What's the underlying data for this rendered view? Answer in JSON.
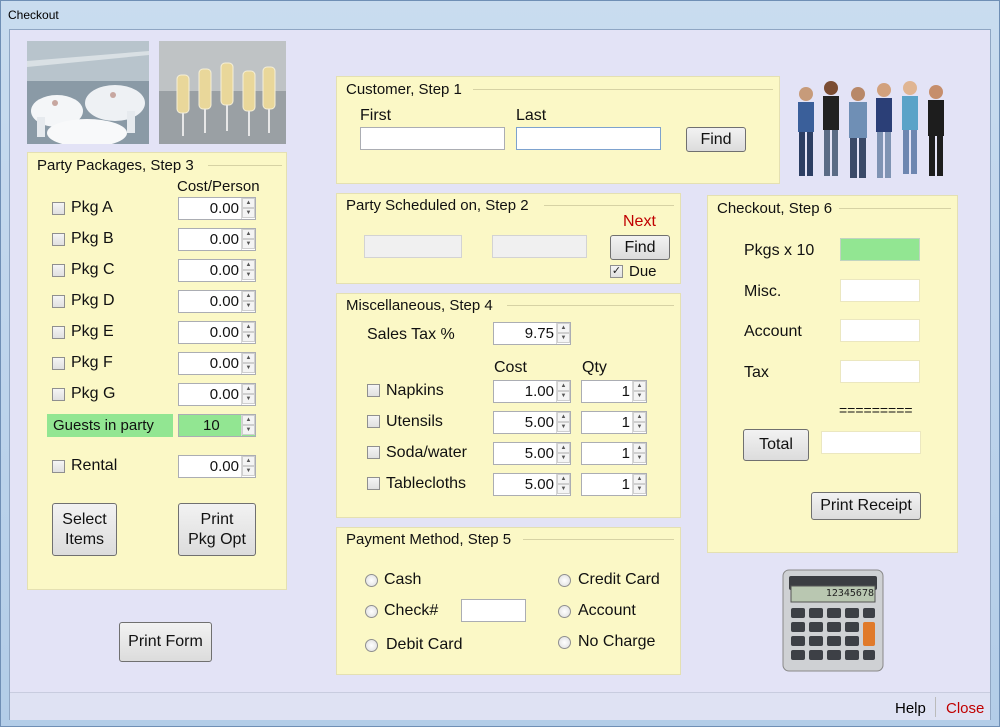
{
  "window": {
    "title": "Checkout"
  },
  "packages": {
    "title": "Party Packages, Step 3",
    "cost_header": "Cost/Person",
    "items": [
      {
        "label": "Pkg A",
        "value": "0.00"
      },
      {
        "label": "Pkg B",
        "value": "0.00"
      },
      {
        "label": "Pkg C",
        "value": "0.00"
      },
      {
        "label": "Pkg D",
        "value": "0.00"
      },
      {
        "label": "Pkg E",
        "value": "0.00"
      },
      {
        "label": "Pkg F",
        "value": "0.00"
      },
      {
        "label": "Pkg G",
        "value": "0.00"
      }
    ],
    "guests_label": "Guests in party",
    "guests_value": "10",
    "rental_label": "Rental",
    "rental_value": "0.00",
    "select_items_line1": "Select",
    "select_items_line2": "Items",
    "print_pkg_line1": "Print",
    "print_pkg_line2": "Pkg Opt"
  },
  "print_form_label": "Print Form",
  "customer": {
    "title": "Customer, Step 1",
    "first_label": "First",
    "last_label": "Last",
    "first_value": "",
    "last_value": "",
    "find_label": "Find"
  },
  "schedule": {
    "title": "Party Scheduled on, Step 2",
    "next_label": "Next",
    "find_label": "Find",
    "due_label": "Due",
    "due_checked": true
  },
  "misc": {
    "title": "Miscellaneous, Step 4",
    "sales_tax_label": "Sales Tax %",
    "sales_tax_value": "9.75",
    "cost_header": "Cost",
    "qty_header": "Qty",
    "items": [
      {
        "label": "Napkins",
        "cost": "1.00",
        "qty": "1"
      },
      {
        "label": "Utensils",
        "cost": "5.00",
        "qty": "1"
      },
      {
        "label": "Soda/water",
        "cost": "5.00",
        "qty": "1"
      },
      {
        "label": "Tablecloths",
        "cost": "5.00",
        "qty": "1"
      }
    ]
  },
  "payment": {
    "title": "Payment Method, Step 5",
    "cash": "Cash",
    "check": "Check#",
    "debit": "Debit Card",
    "credit": "Credit Card",
    "account": "Account",
    "no_charge": "No Charge"
  },
  "checkout": {
    "title": "Checkout, Step 6",
    "pkgs_label": "Pkgs x 10",
    "misc_label": "Misc.",
    "account_label": "Account",
    "tax_label": "Tax",
    "separator": "=========",
    "total_label": "Total",
    "print_receipt_label": "Print Receipt"
  },
  "calculator": {
    "display": "12345678"
  },
  "status": {
    "help": "Help",
    "close": "Close"
  },
  "colors": {
    "panel": "#fbf8c6",
    "accent_green": "#92e692",
    "close_red": "#c00000"
  }
}
